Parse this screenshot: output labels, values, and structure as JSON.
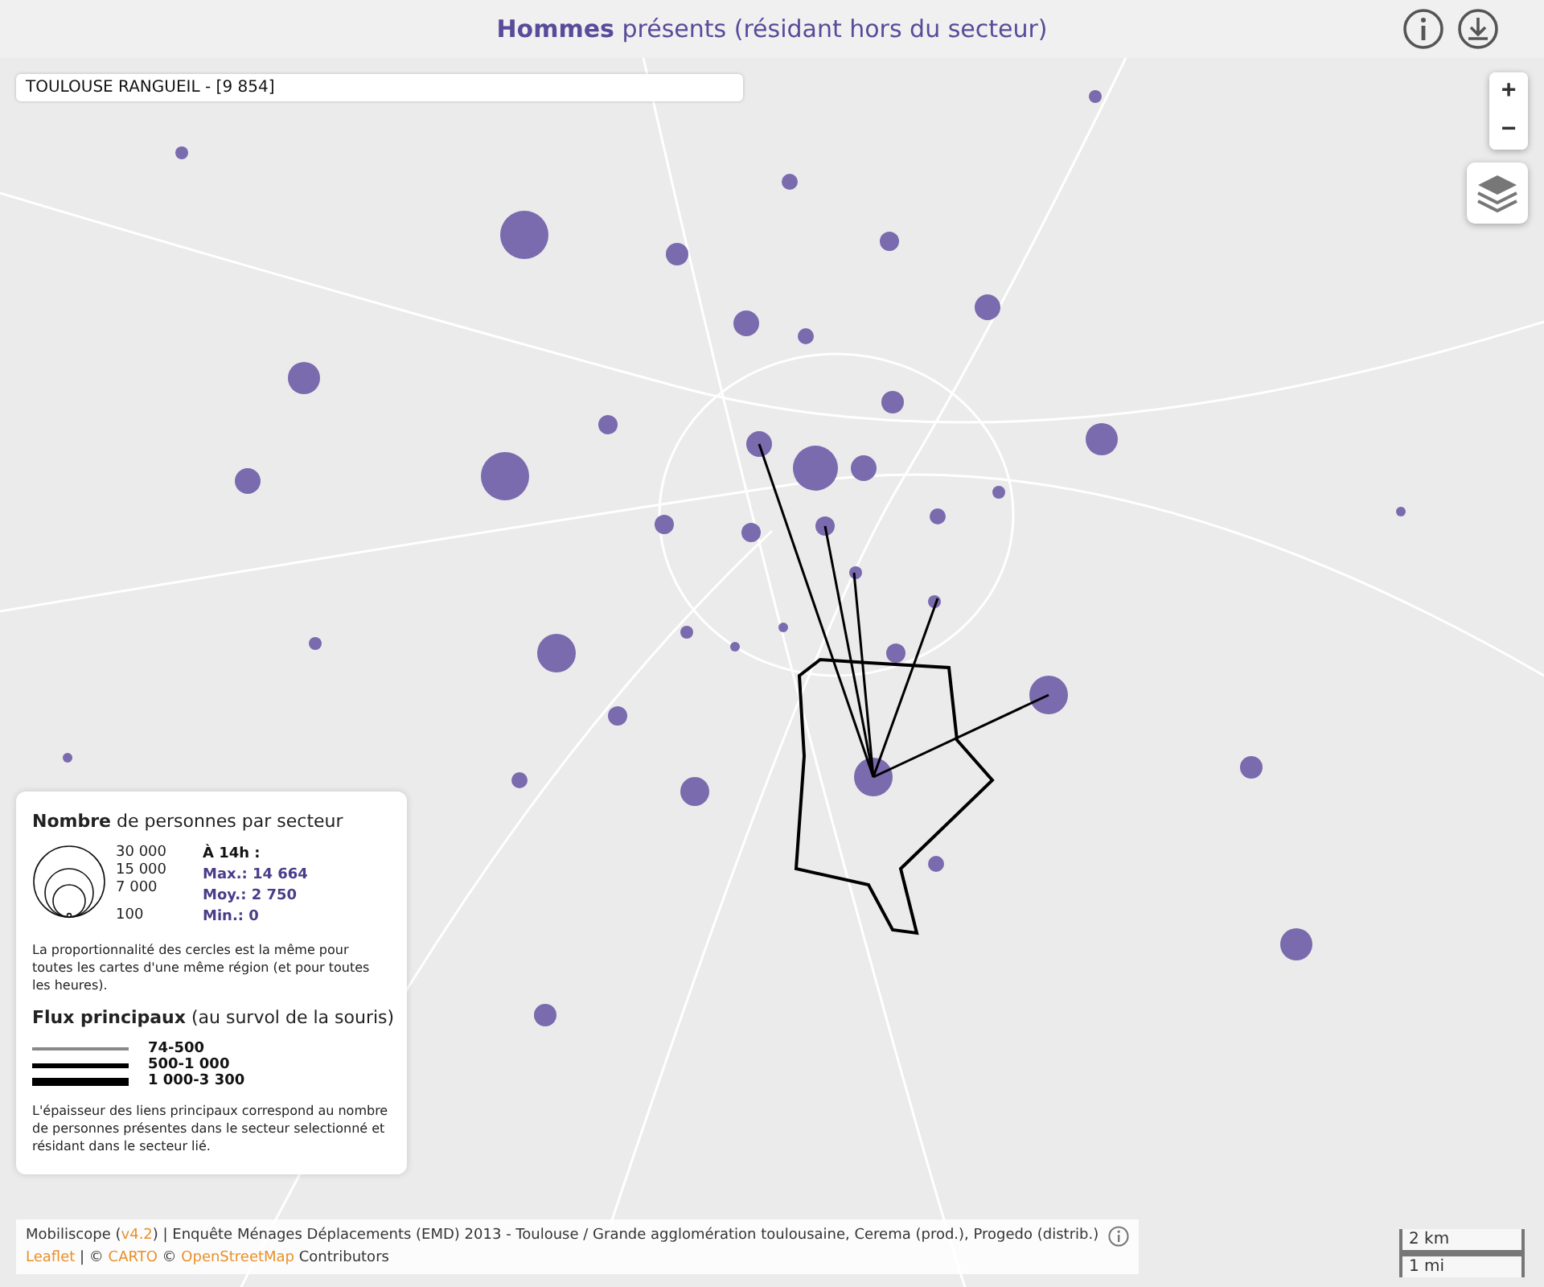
{
  "header": {
    "title": "**Hommes** présents (résidant hors du secteur)"
  },
  "sector": {
    "label": "TOULOUSE RANGUEIL - [9 854]"
  },
  "zoom": {
    "in": "+",
    "out": "−"
  },
  "legend": {
    "title": "**Nombre** de personnes par secteur",
    "scale": [
      "30 000",
      "15 000",
      "7 000",
      "100"
    ],
    "hour": "À 14h :",
    "stats": [
      "Max.: 14 664",
      "Moy.: 2 750",
      "Min.: 0"
    ],
    "note": "La proportionnalité des cercles est la même pour toutes les cartes d'une même région (et pour toutes les heures).",
    "flux_title": "**Flux principaux** (au survol de la souris)",
    "flux": [
      {
        "label": "74-500",
        "kind": "thin"
      },
      {
        "label": "500-1 000",
        "kind": "medium"
      },
      {
        "label": "1 000-3 300",
        "kind": "thick"
      }
    ],
    "flux_note": "L'épaisseur des liens principaux correspond au nombre de personnes présentes dans le secteur selectionné et résidant dans le secteur lié."
  },
  "attribution": {
    "lines": [
      [
        {
          "kind": "text",
          "text": "Mobiliscope ("
        },
        {
          "kind": "link",
          "text": "v4.2"
        },
        {
          "kind": "text",
          "text": ") | Enquête Ménages Déplacements (EMD) 2013 - Toulouse / Grande agglomération toulousaine, Cerema (prod.), Progedo (distrib.)"
        }
      ],
      [
        {
          "kind": "link",
          "text": "Leaflet"
        },
        {
          "kind": "text",
          "text": " | © "
        },
        {
          "kind": "link",
          "text": "CARTO"
        },
        {
          "kind": "text",
          "text": " © "
        },
        {
          "kind": "link",
          "text": "OpenStreetMap"
        },
        {
          "kind": "text",
          "text": " Contributors"
        }
      ]
    ]
  },
  "scale_bar": [
    "2 km",
    "1 mi"
  ]
}
